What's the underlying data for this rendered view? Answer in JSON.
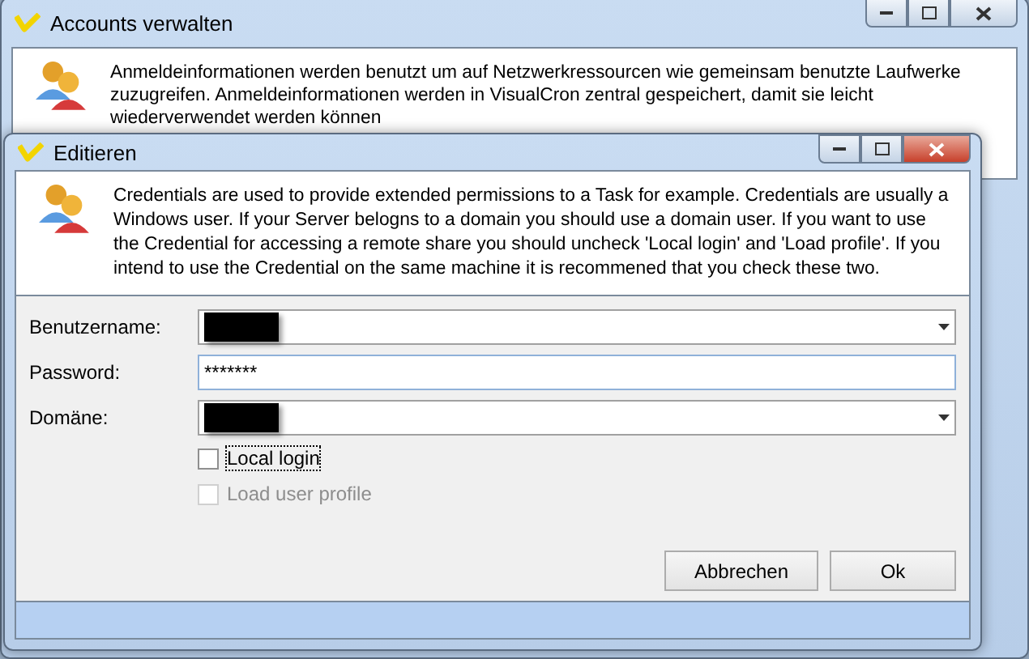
{
  "back_window": {
    "title": "Accounts verwalten",
    "description": "Anmeldeinformationen werden benutzt um auf Netzwerkressourcen wie gemeinsam benutzte Laufwerke zuzugreifen. Anmeldeinformationen werden in VisualCron zentral gespeichert, damit sie leicht wiederverwendet werden können"
  },
  "dialog": {
    "title": "Editieren",
    "description": "Credentials are used to provide extended permissions to a Task for example. Credentials are usually a Windows user. If your Server belogns to a domain you should use a domain user. If you want to use the Credential for accessing a remote share you should uncheck 'Local login' and 'Load profile'. If you intend to use the Credential on the same machine it is recommened that you check these two.",
    "fields": [
      {
        "kind": "combo",
        "label": "Benutzername:",
        "redacted": true
      },
      {
        "kind": "password",
        "label": "Password:",
        "value": "*******"
      },
      {
        "kind": "combo",
        "label": "Domäne:",
        "redacted": true
      }
    ],
    "checkboxes": [
      {
        "label": "Local login",
        "checked": false,
        "disabled": false,
        "focused": true
      },
      {
        "label": "Load user profile",
        "checked": false,
        "disabled": true,
        "focused": false
      }
    ],
    "buttons": [
      "Abbrechen",
      "Ok"
    ]
  }
}
